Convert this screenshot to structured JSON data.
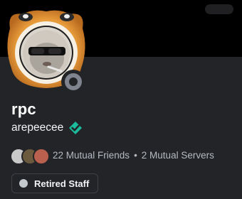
{
  "profile": {
    "display_name": "rpc",
    "username": "arepeecee",
    "status": "offline",
    "badge_icon": "diamond-badge-icon",
    "badge_color": "#1abc9c"
  },
  "mutuals": {
    "friends": "22 Mutual Friends",
    "separator": "•",
    "servers": "2 Mutual Servers"
  },
  "roles": [
    {
      "label": "Retired Staff",
      "color": "#c4c9ce"
    }
  ],
  "colors": {
    "background": "#232428",
    "banner": "#000000",
    "text_primary": "#f2f3f5",
    "text_muted": "#b5bac1"
  }
}
